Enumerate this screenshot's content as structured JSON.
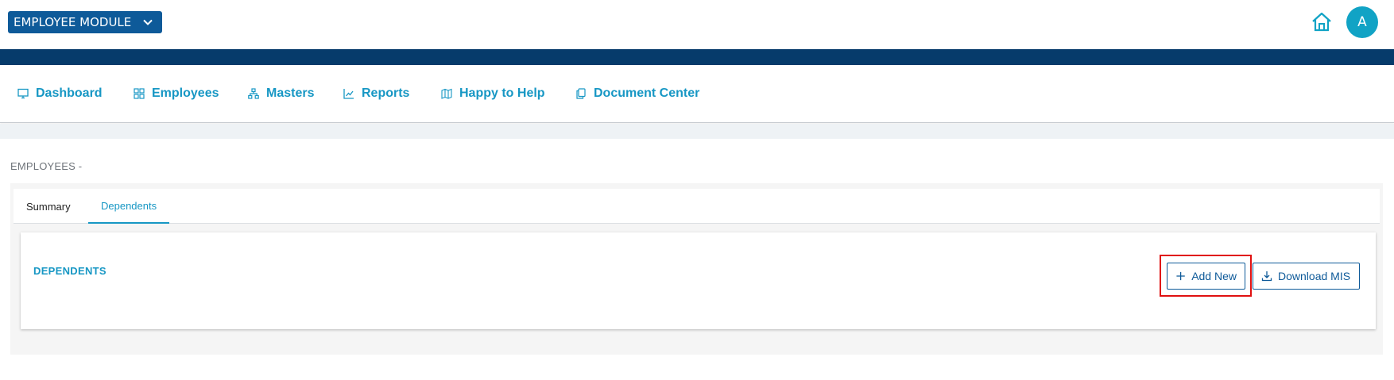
{
  "header": {
    "module_label": "EMPLOYEE MODULE",
    "avatar_initial": "A"
  },
  "nav": {
    "items": [
      {
        "label": "Dashboard",
        "icon": "monitor-icon"
      },
      {
        "label": "Employees",
        "icon": "grid-icon"
      },
      {
        "label": "Masters",
        "icon": "hierarchy-icon"
      },
      {
        "label": "Reports",
        "icon": "line-chart-icon"
      },
      {
        "label": "Happy to Help",
        "icon": "map-icon"
      },
      {
        "label": "Document Center",
        "icon": "documents-icon"
      }
    ]
  },
  "page": {
    "title": "EMPLOYEES -"
  },
  "tabs": [
    {
      "label": "Summary",
      "active": false
    },
    {
      "label": "Dependents",
      "active": true
    }
  ],
  "dependents": {
    "title": "DEPENDENTS",
    "add_label": "Add New",
    "download_label": "Download MIS"
  },
  "colors": {
    "primary": "#0e5a99",
    "navy_bar": "#063b6b",
    "accent": "#1797c4",
    "avatar": "#11a3c5",
    "highlight": "#e01010"
  }
}
